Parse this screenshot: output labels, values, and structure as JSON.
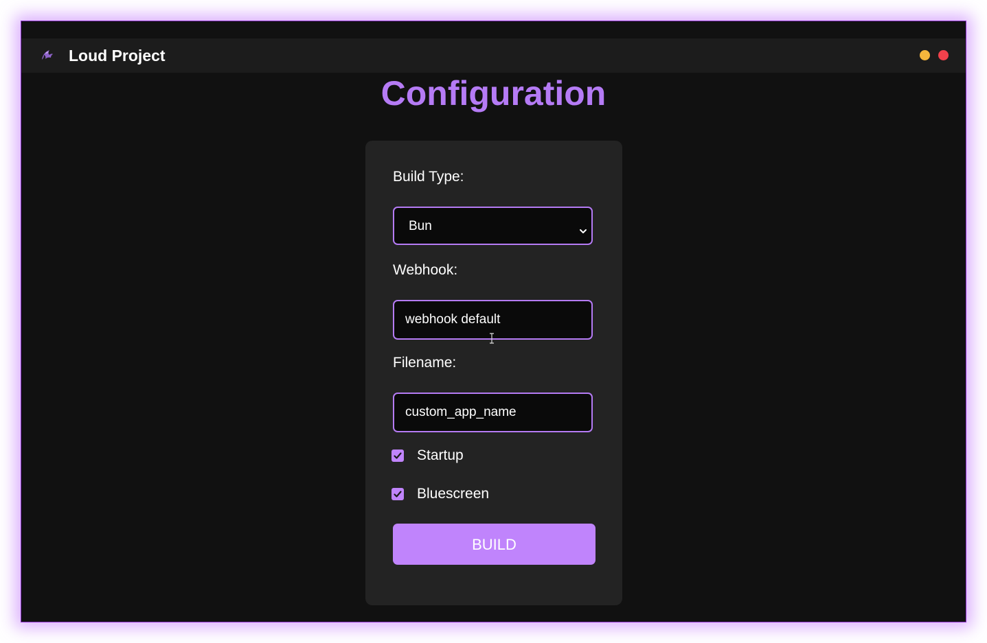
{
  "app": {
    "title": "Loud Project",
    "icon": "phoenix-logo-icon"
  },
  "window_controls": {
    "minimize_color": "#f5b63c",
    "close_color": "#f0414b"
  },
  "page": {
    "title": "Configuration"
  },
  "form": {
    "build_type": {
      "label": "Build Type:",
      "value": "Bun"
    },
    "webhook": {
      "label": "Webhook:",
      "value": "webhook default"
    },
    "filename": {
      "label": "Filename:",
      "value": "custom_app_name"
    },
    "startup": {
      "label": "Startup",
      "checked": true
    },
    "bluescreen": {
      "label": "Bluescreen",
      "checked": true
    },
    "build_button": "BUILD"
  },
  "colors": {
    "accent": "#b57bf5",
    "button": "#c084fc",
    "background": "#111111",
    "card": "#232323"
  }
}
